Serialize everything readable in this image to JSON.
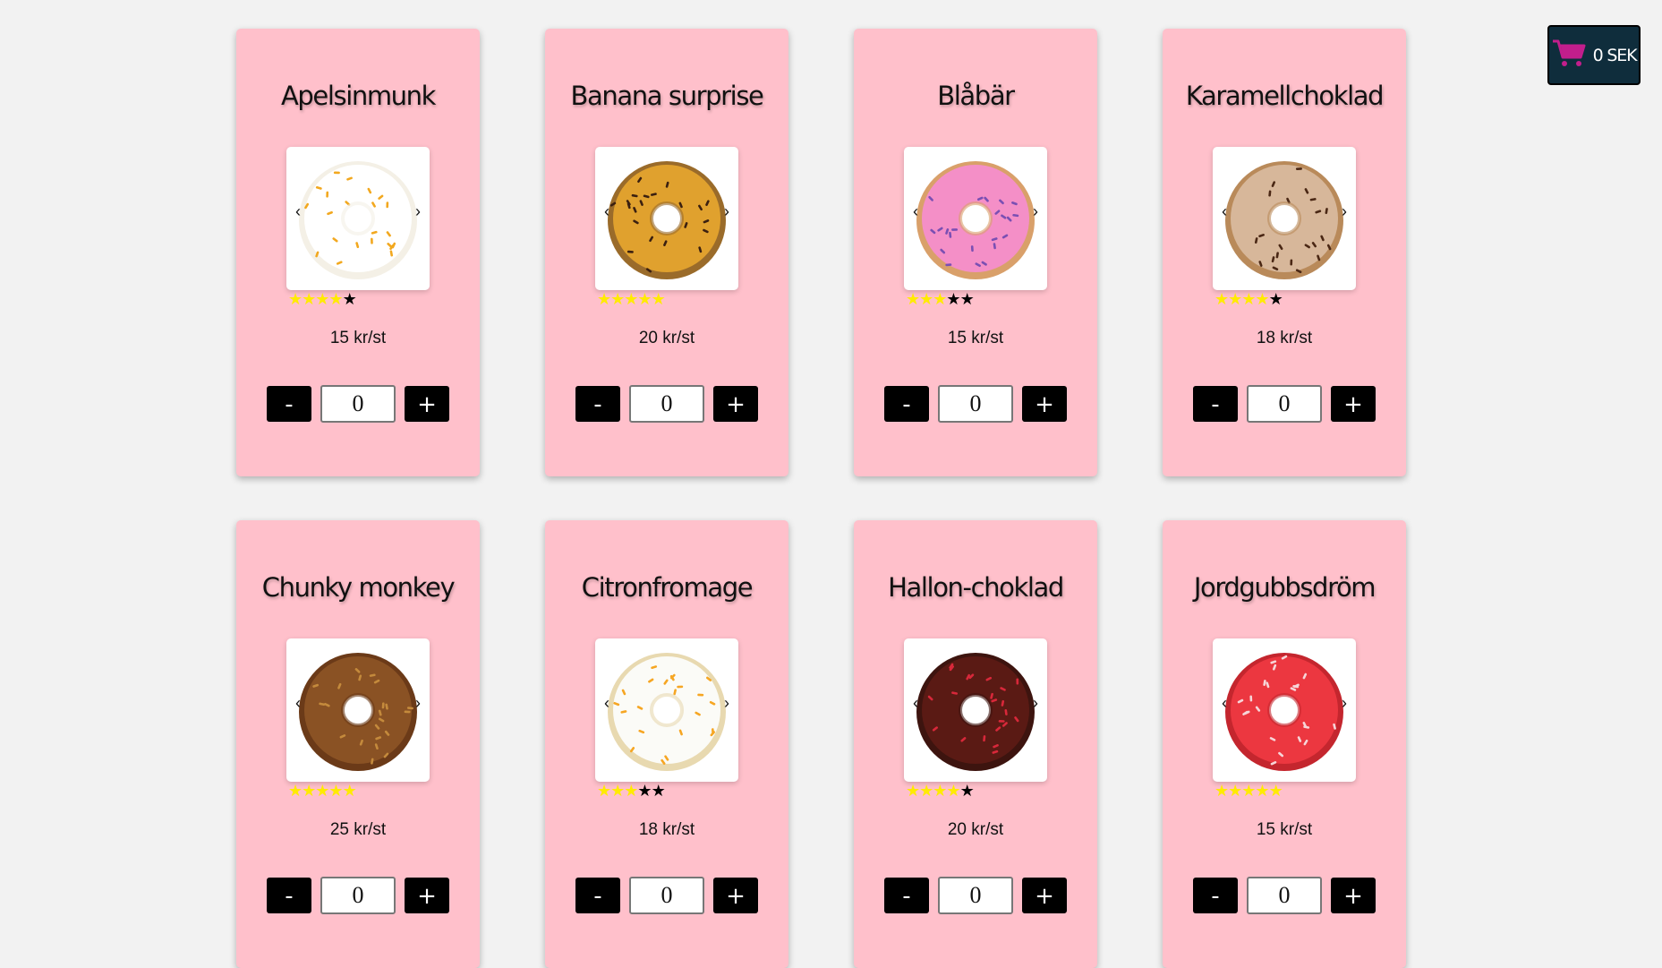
{
  "cart": {
    "total": "0 SEK",
    "icon": "cart-icon"
  },
  "colors": {
    "card_bg": "#ffc0cb",
    "star_on": "#ffeb00",
    "star_off": "#000000",
    "cart_bg": "#0f2d3c",
    "cart_icon": "#c21e8c"
  },
  "controls": {
    "minus": "-",
    "plus": "+",
    "prev": "‹",
    "next": "›"
  },
  "products": [
    {
      "name": "Apelsinmunk",
      "price": "15 kr/st",
      "rating": 4,
      "quantity": "0",
      "glaze": "#ffffff",
      "drizzle": "#f2a81f",
      "base": "#f4f0e6"
    },
    {
      "name": "Banana surprise",
      "price": "20 kr/st",
      "rating": 5,
      "quantity": "0",
      "glaze": "#e0a12e",
      "drizzle": "#3b2010",
      "base": "#9a6b2a"
    },
    {
      "name": "Blåbär",
      "price": "15 kr/st",
      "rating": 3,
      "quantity": "0",
      "glaze": "#f48fc7",
      "drizzle": "#7a4fb3",
      "base": "#d9a06a"
    },
    {
      "name": "Karamellchoklad",
      "price": "18 kr/st",
      "rating": 4,
      "quantity": "0",
      "glaze": "#d7b79a",
      "drizzle": "#4a2714",
      "base": "#b98a5a"
    },
    {
      "name": "Chunky monkey",
      "price": "25 kr/st",
      "rating": 5,
      "quantity": "0",
      "glaze": "#8a5224",
      "drizzle": "#c48a3c",
      "base": "#6b3a18"
    },
    {
      "name": "Citronfromage",
      "price": "18 kr/st",
      "rating": 3,
      "quantity": "0",
      "glaze": "#fbfbf7",
      "drizzle": "#f6a623",
      "base": "#e8d9b0"
    },
    {
      "name": "Hallon-choklad",
      "price": "20 kr/st",
      "rating": 4,
      "quantity": "0",
      "glaze": "#5a1a14",
      "drizzle": "#d8283a",
      "base": "#3d140f"
    },
    {
      "name": "Jordgubbsdröm",
      "price": "15 kr/st",
      "rating": 5,
      "quantity": "0",
      "glaze": "#ec3740",
      "drizzle": "#f6d5d8",
      "base": "#c4262e"
    }
  ]
}
